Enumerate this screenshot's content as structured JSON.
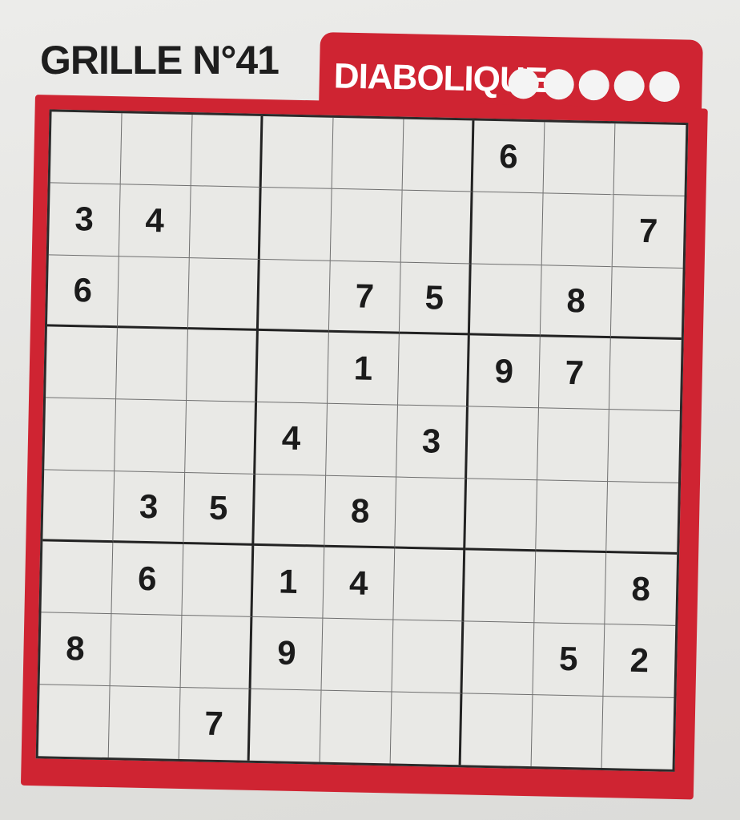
{
  "header": {
    "title": "GRILLE N°41",
    "difficulty": "DIABOLIQUE",
    "difficulty_dots": 5
  },
  "colors": {
    "accent": "#cf2432",
    "grid_bg": "#e9e9e6",
    "digit": "#1b1b1b"
  },
  "grid": [
    [
      "",
      "",
      "",
      "",
      "",
      "",
      "6",
      "",
      ""
    ],
    [
      "3",
      "4",
      "",
      "",
      "",
      "",
      "",
      "",
      "7"
    ],
    [
      "6",
      "",
      "",
      "",
      "7",
      "5",
      "",
      "8",
      ""
    ],
    [
      "",
      "",
      "",
      "",
      "1",
      "",
      "9",
      "7",
      ""
    ],
    [
      "",
      "",
      "",
      "4",
      "",
      "3",
      "",
      "",
      ""
    ],
    [
      "",
      "3",
      "5",
      "",
      "8",
      "",
      "",
      "",
      ""
    ],
    [
      "",
      "6",
      "",
      "1",
      "4",
      "",
      "",
      "",
      "8"
    ],
    [
      "8",
      "",
      "",
      "9",
      "",
      "",
      "",
      "5",
      "2"
    ],
    [
      "",
      "",
      "7",
      "",
      "",
      "",
      "",
      "",
      ""
    ]
  ]
}
